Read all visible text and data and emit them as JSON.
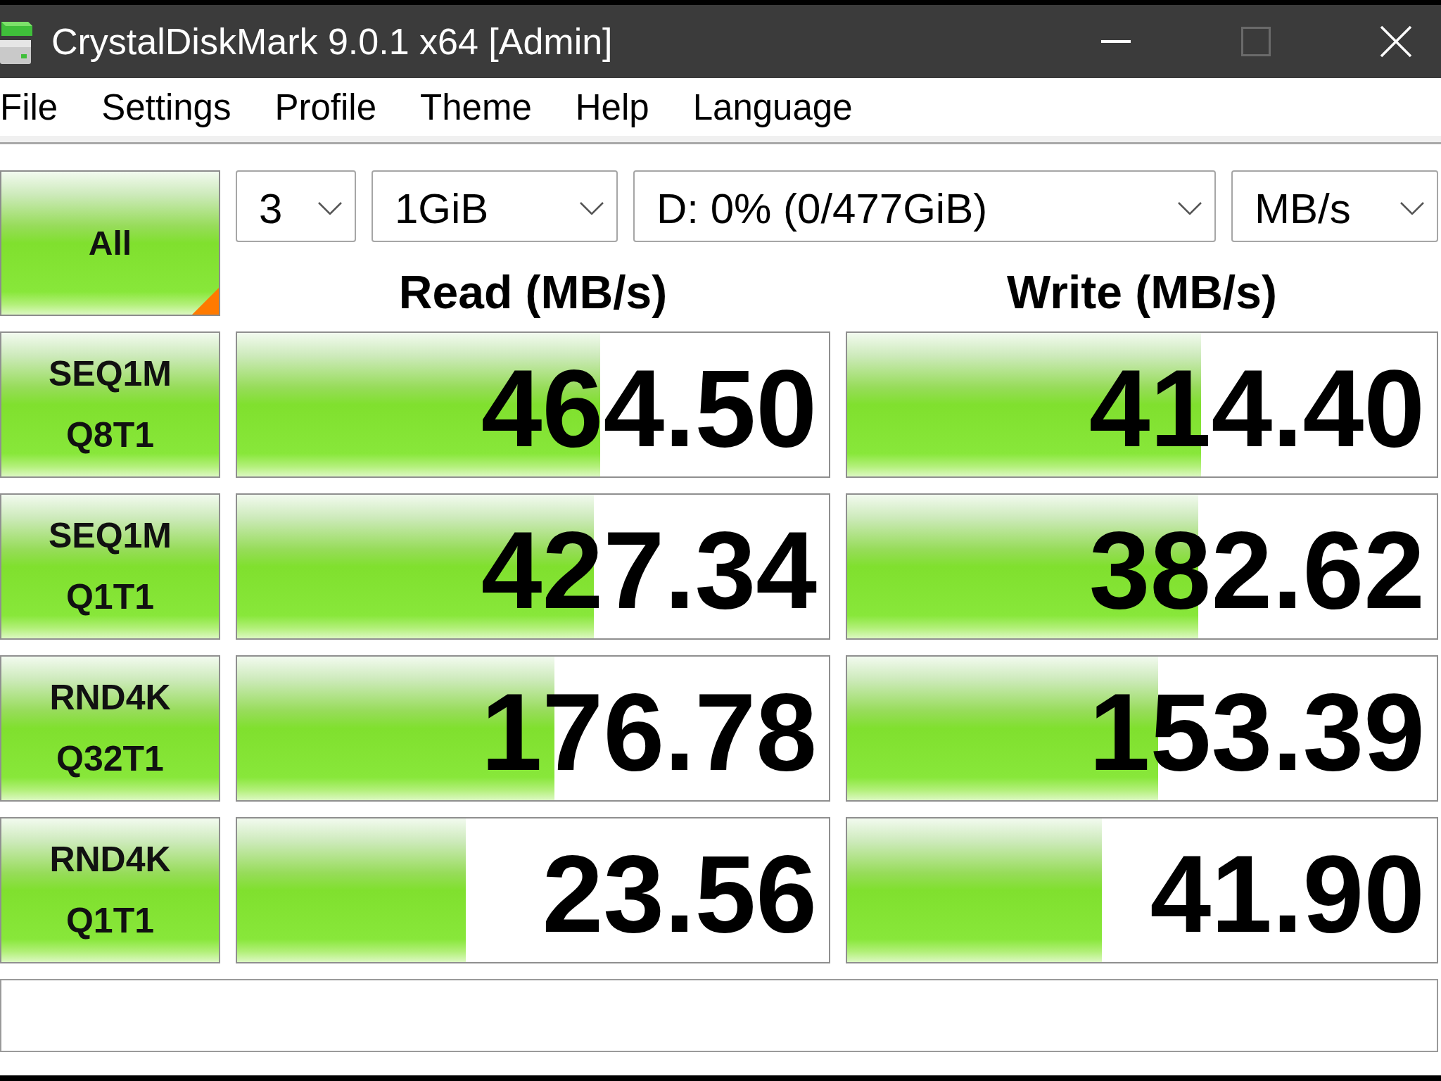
{
  "window": {
    "title": "CrystalDiskMark 9.0.1 x64 [Admin]",
    "controls": [
      {
        "kind": "minimize",
        "disabled": false
      },
      {
        "kind": "maximize",
        "disabled": true
      },
      {
        "kind": "close",
        "disabled": false
      }
    ]
  },
  "menu": [
    "File",
    "Settings",
    "Profile",
    "Theme",
    "Help",
    "Language"
  ],
  "toolbar": {
    "all_button": "All",
    "dropdowns": [
      "3",
      "1GiB",
      "D: 0% (0/477GiB)",
      "MB/s"
    ]
  },
  "columns": [
    "Read (MB/s)",
    "Write (MB/s)"
  ],
  "tests": [
    {
      "label": [
        "SEQ1M",
        "Q8T1"
      ],
      "read": {
        "value": "464.50",
        "level": 0.613
      },
      "write": {
        "value": "414.40",
        "level": 0.6
      }
    },
    {
      "label": [
        "SEQ1M",
        "Q1T1"
      ],
      "read": {
        "value": "427.34",
        "level": 0.603
      },
      "write": {
        "value": "382.62",
        "level": 0.596
      }
    },
    {
      "label": [
        "RND4K",
        "Q32T1"
      ],
      "read": {
        "value": "176.78",
        "level": 0.536
      },
      "write": {
        "value": "153.39",
        "level": 0.527
      }
    },
    {
      "label": [
        "RND4K",
        "Q1T1"
      ],
      "read": {
        "value": "23.56",
        "level": 0.387
      },
      "write": {
        "value": "41.90",
        "level": 0.432
      }
    }
  ]
}
